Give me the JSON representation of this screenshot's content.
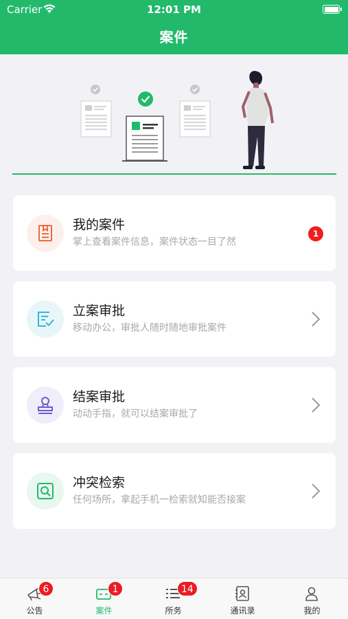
{
  "status_bar": {
    "carrier": "Carrier",
    "time": "12:01 PM"
  },
  "nav": {
    "title": "案件"
  },
  "cards": [
    {
      "title": "我的案件",
      "desc": "掌上查看案件信息，案件状态一目了然",
      "badge": "1",
      "icon": "document-icon",
      "color": "#ef6a3a",
      "bg": "#fdf0ec"
    },
    {
      "title": "立案审批",
      "desc": "移动办公，审批人随时随地审批案件",
      "icon": "approval-check-icon",
      "color": "#35b6d6",
      "bg": "#e8f6fa"
    },
    {
      "title": "结案审批",
      "desc": "动动手指，就可以结案审批了",
      "icon": "stamp-icon",
      "color": "#6c5bd0",
      "bg": "#f0eefa"
    },
    {
      "title": "冲突检索",
      "desc": "任何场所，拿起手机一检索就知能否接案",
      "icon": "search-icon",
      "color": "#22b96b",
      "bg": "#e8f7ef"
    }
  ],
  "tabbar": {
    "tabs": [
      {
        "label": "公告",
        "badge": "6",
        "icon": "megaphone-icon"
      },
      {
        "label": "案件",
        "badge": "1",
        "icon": "case-icon",
        "active": true
      },
      {
        "label": "所务",
        "badge": "14",
        "icon": "list-icon"
      },
      {
        "label": "通讯录",
        "icon": "contacts-icon"
      },
      {
        "label": "我的",
        "icon": "profile-icon"
      }
    ]
  },
  "colors": {
    "brand": "#22b96b",
    "badge": "#f01d1d"
  }
}
